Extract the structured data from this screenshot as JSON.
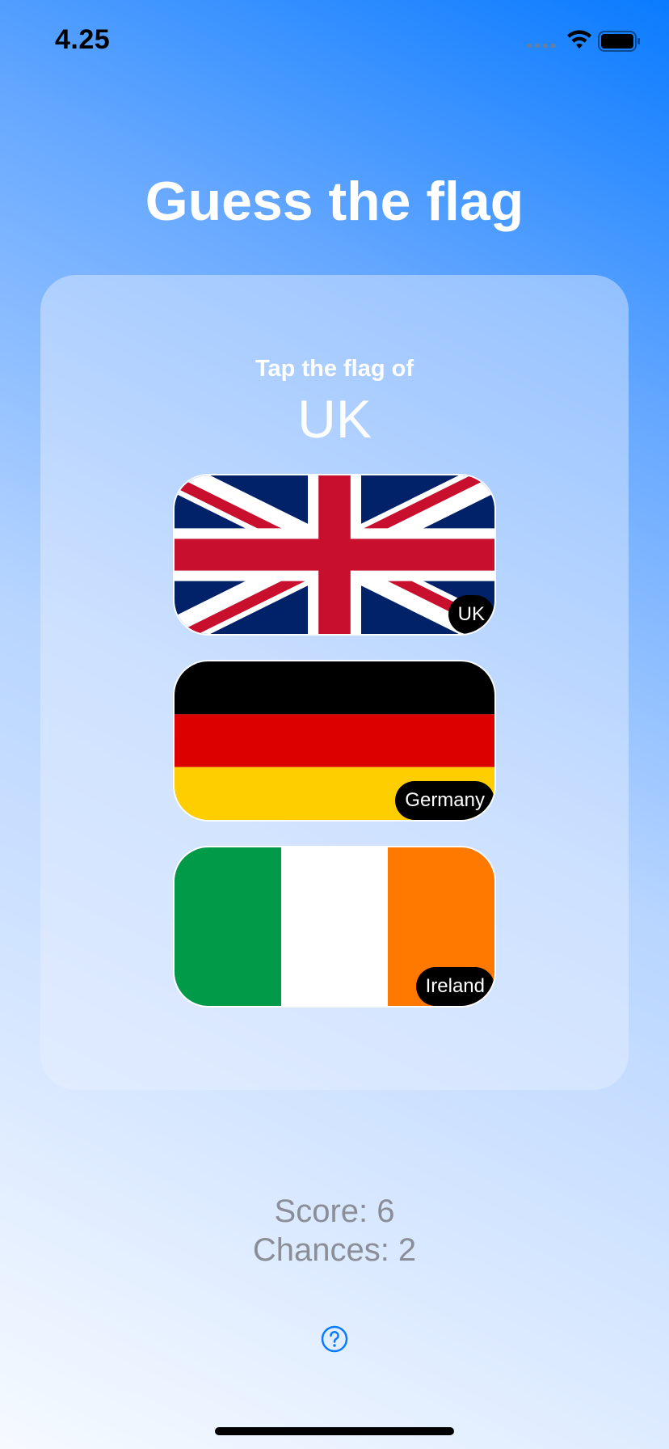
{
  "status_bar": {
    "time": "4.25",
    "icons": [
      "cellular-signal-icon",
      "wifi-icon",
      "battery-icon"
    ]
  },
  "title": "Guess the flag",
  "prompt": {
    "subtitle": "Tap the flag of",
    "country": "UK"
  },
  "flags": [
    {
      "label": "UK",
      "icon": "uk-flag"
    },
    {
      "label": "Germany",
      "icon": "germany-flag"
    },
    {
      "label": "Ireland",
      "icon": "ireland-flag"
    }
  ],
  "stats": {
    "score": "Score: 6",
    "chances": "Chances: 2"
  },
  "help": {
    "icon": "question-circle-icon"
  },
  "colors": {
    "accent": "#0a7bff",
    "uk_blue": "#012169",
    "uk_red": "#C8102E",
    "germany_black": "#000000",
    "germany_red": "#DD0000",
    "germany_gold": "#FFCE00",
    "ireland_green": "#009A49",
    "ireland_orange": "#FF7900"
  }
}
